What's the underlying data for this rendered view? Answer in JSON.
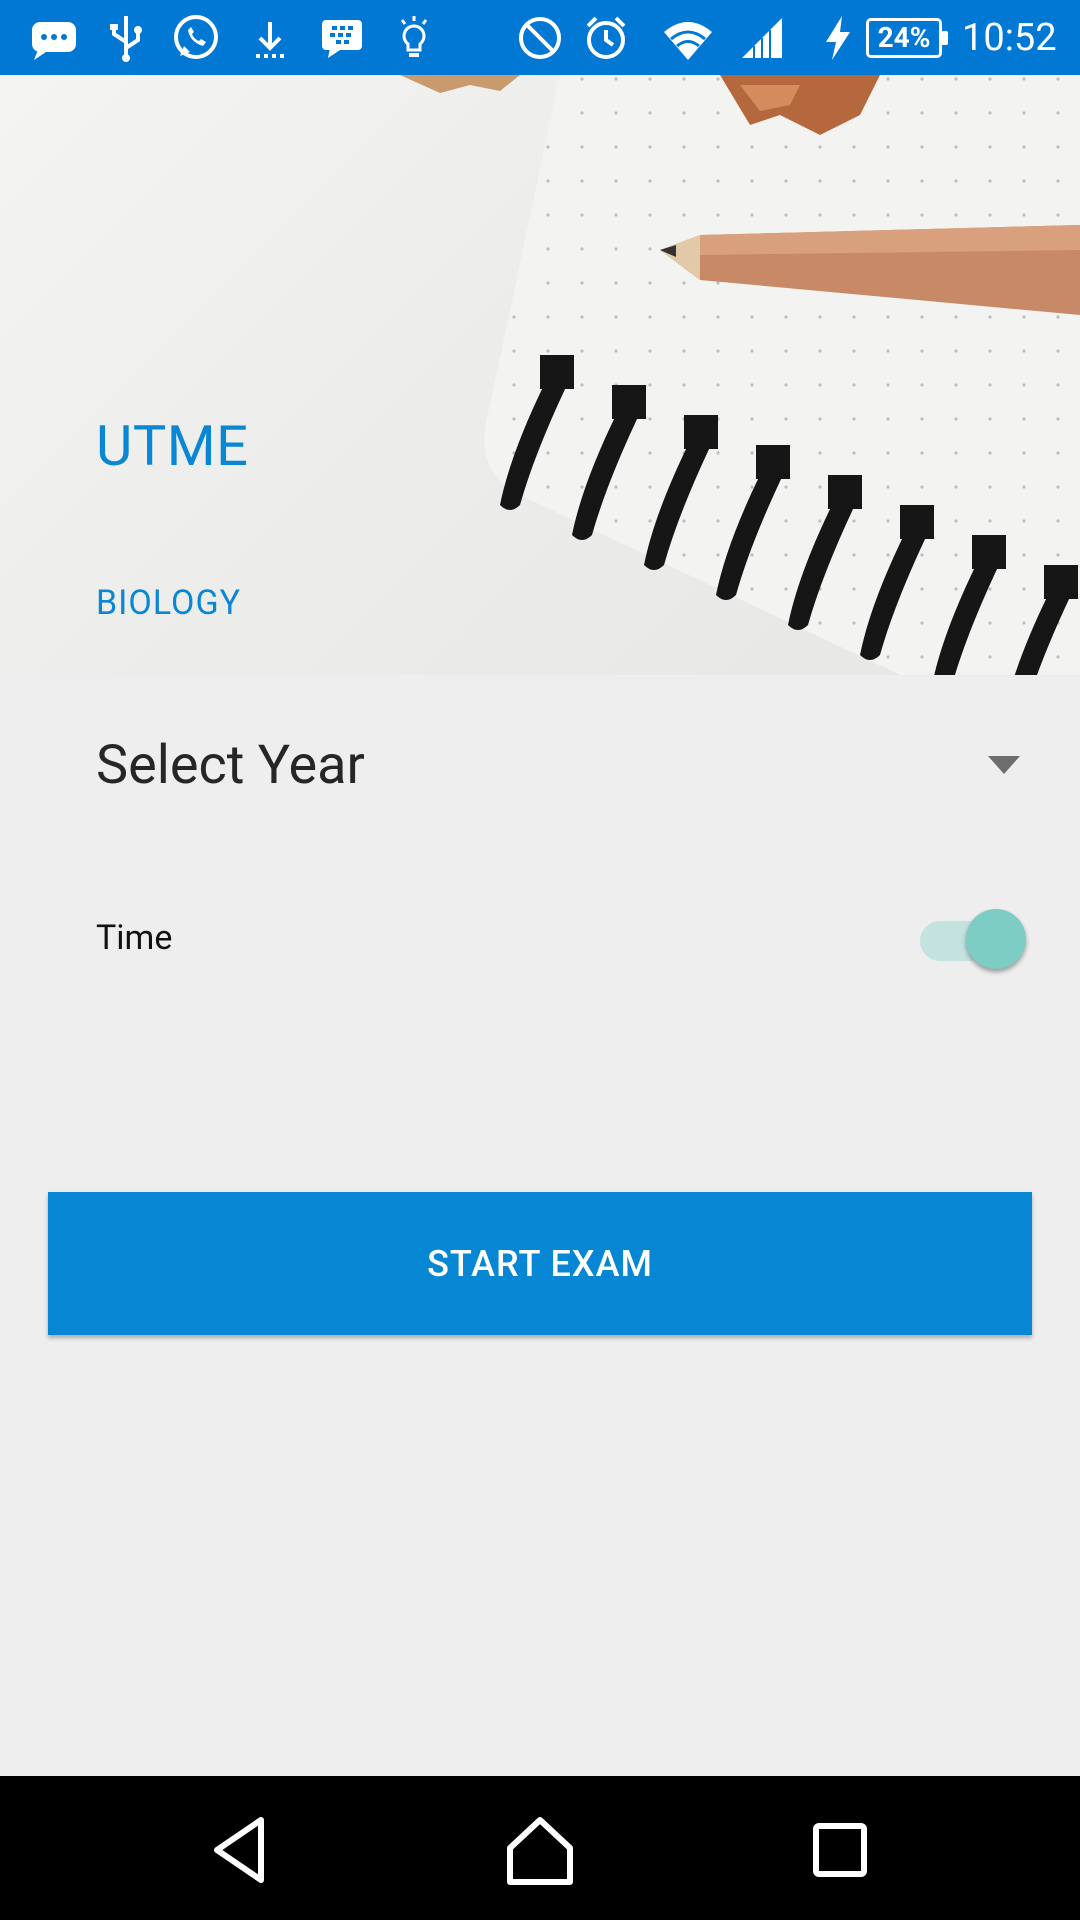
{
  "status_bar": {
    "time": "10:52",
    "battery_percent": "24%",
    "icons": [
      "message-icon",
      "usb-icon",
      "whatsapp-icon",
      "download-icon",
      "bbm-icon",
      "bulb-icon",
      "do-not-disturb-icon",
      "alarm-icon",
      "wifi-icon",
      "signal-icon",
      "charging-icon",
      "battery-icon"
    ]
  },
  "header": {
    "title": "UTME",
    "subject": "BIOLOGY"
  },
  "form": {
    "year_select_label": "Select Year",
    "time_label": "Time",
    "time_toggle_on": true
  },
  "actions": {
    "start_label": "START EXAM"
  },
  "nav_bar": {
    "buttons": [
      "back-icon",
      "home-icon",
      "recents-icon"
    ]
  },
  "colors": {
    "status_bar": "#0078d4",
    "accent": "#0a87d4",
    "button": "#0787d3",
    "toggle_thumb": "#7ecdc4",
    "toggle_track": "#c4e3e0",
    "background": "#eeeeee"
  }
}
